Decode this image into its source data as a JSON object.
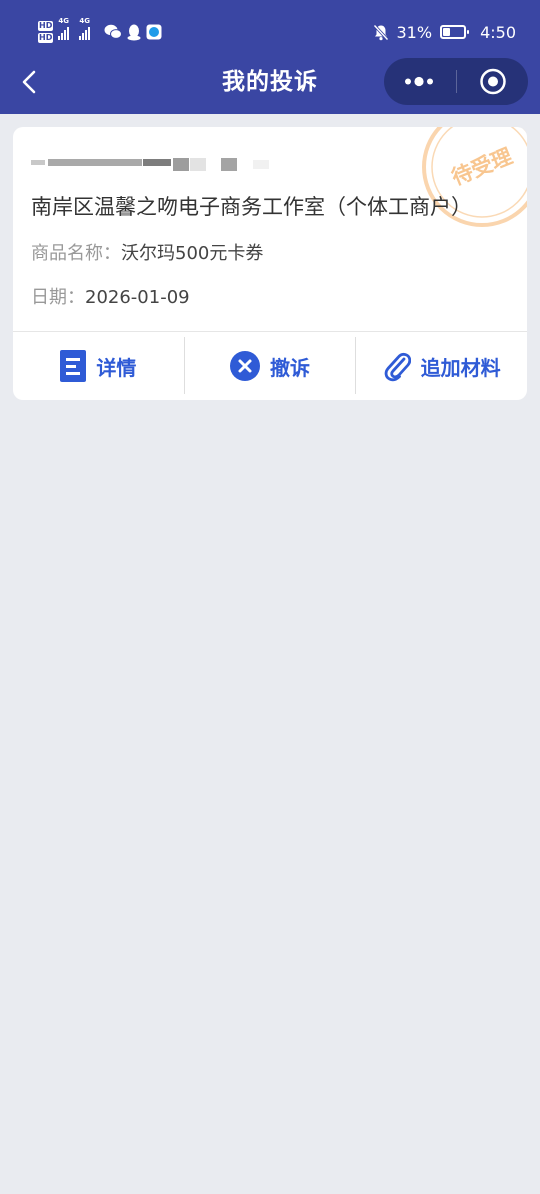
{
  "status_bar": {
    "hd1": "HD",
    "hd2": "HD",
    "net1": "4G",
    "net2": "4G",
    "battery": "31%",
    "time": "4:50"
  },
  "nav": {
    "title": "我的投诉"
  },
  "complaint": {
    "status_stamp": "待受理",
    "merchant": "南岸区温馨之吻电子商务工作室（个体工商户）",
    "product_label": "商品名称：",
    "product_value": "沃尔玛500元卡券",
    "date_label": "日期：",
    "date_value": "2026-01-09",
    "actions": [
      {
        "label": "详情",
        "icon": "document-icon"
      },
      {
        "label": "撤诉",
        "icon": "close-circle-icon"
      },
      {
        "label": "追加材料",
        "icon": "paperclip-icon"
      }
    ]
  },
  "colors": {
    "header": "#3a46a3",
    "accent": "#2f5bd6",
    "stamp": "#f6b36b",
    "background": "#e9ebf0"
  }
}
